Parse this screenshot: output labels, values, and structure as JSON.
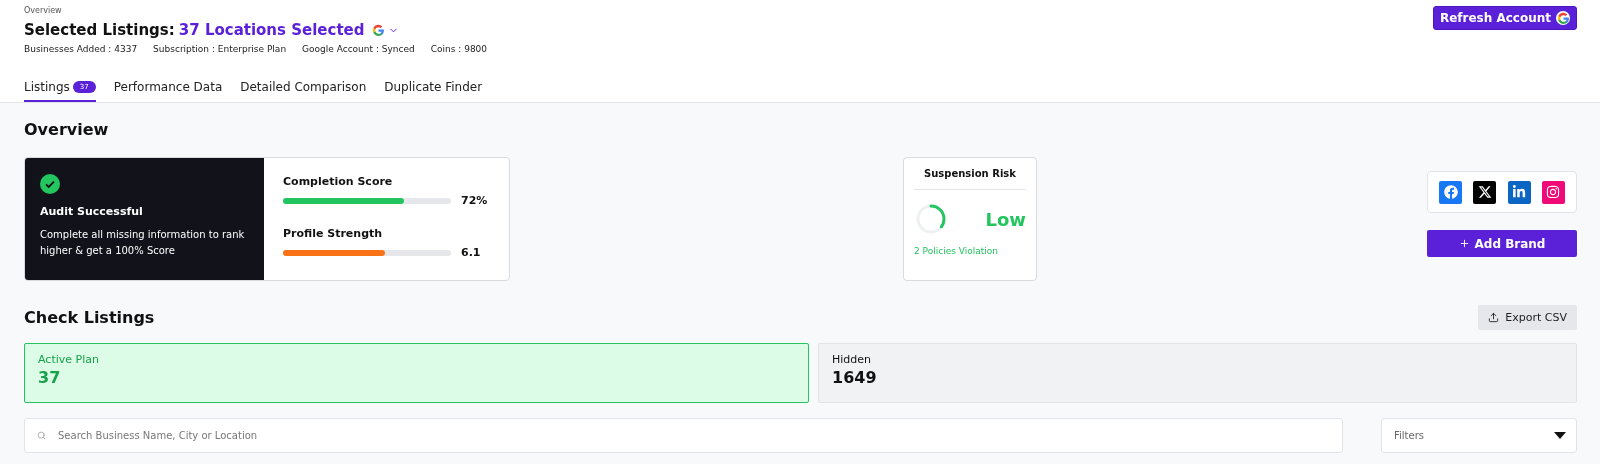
{
  "header": {
    "breadcrumb": "Overview",
    "title": "Selected Listings:",
    "selection": "37 Locations Selected",
    "stats": [
      "Businesses Added : 4337",
      "Subscription : Enterprise Plan",
      "Google Account : Synced",
      "Coins : 9800"
    ],
    "refresh_button": "Refresh Account"
  },
  "tabs": [
    {
      "label": "Listings",
      "badge": "37",
      "selected": true
    },
    {
      "label": "Performance Data",
      "selected": false
    },
    {
      "label": "Detailed Comparison",
      "selected": false
    },
    {
      "label": "Duplicate Finder",
      "selected": false
    }
  ],
  "overview": {
    "title": "Overview",
    "audit": {
      "title": "Audit Successful",
      "message": "Complete all missing information to rank higher & get a 100% Score"
    },
    "scores": [
      {
        "label": "Completion Score",
        "level": 0.72,
        "reading": "72%",
        "color": "#22c55e"
      },
      {
        "label": "Profile Strength",
        "level": 0.61,
        "reading": "6.1",
        "color": "#f97316"
      }
    ],
    "suspension": {
      "title": "Suspension Risk",
      "risk": "Low",
      "note": "2 Policies Violation"
    },
    "add_brand": "Add Brand"
  },
  "check_listings": {
    "title": "Check Listings",
    "export_button": "Export CSV",
    "plans": [
      {
        "label": "Active Plan",
        "count": "37",
        "selected": true
      },
      {
        "label": "Hidden",
        "count": "1649",
        "selected": false
      }
    ],
    "search": {
      "placeholder": "Search Business Name, City or Location"
    },
    "filters": {
      "placeholder": "Filters"
    }
  }
}
